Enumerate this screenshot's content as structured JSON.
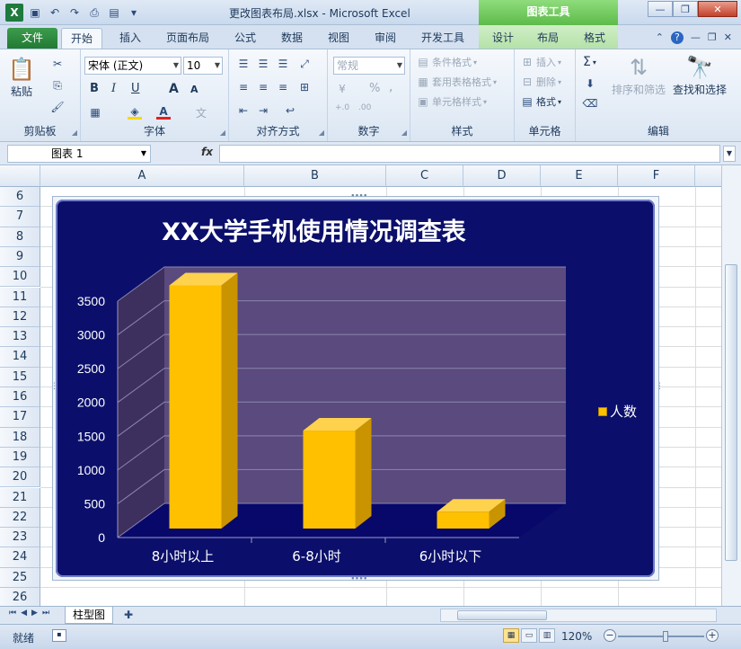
{
  "window": {
    "title": "更改图表布局.xlsx  -  Microsoft Excel",
    "chart_tools": "图表工具"
  },
  "tabs": {
    "file": "文件",
    "items": [
      "开始",
      "插入",
      "页面布局",
      "公式",
      "数据",
      "视图",
      "审阅",
      "开发工具"
    ],
    "context": [
      "设计",
      "布局",
      "格式"
    ]
  },
  "ribbon": {
    "clipboard": {
      "label": "剪贴板",
      "paste": "粘贴"
    },
    "font": {
      "label": "字体",
      "font_name": "宋体 (正文)",
      "font_size": "10",
      "bold": "B",
      "italic": "I",
      "underline": "U",
      "grow": "A",
      "shrink": "A"
    },
    "alignment": {
      "label": "对齐方式"
    },
    "number": {
      "label": "数字",
      "format": "常规",
      "percent": "%",
      "comma": ",",
      "inc": "+.0",
      "dec": ".00"
    },
    "styles": {
      "label": "样式",
      "conditional": "条件格式",
      "table": "套用表格格式",
      "cell": "单元格样式"
    },
    "cells": {
      "label": "单元格",
      "insert": "插入",
      "delete": "删除",
      "format": "格式"
    },
    "editing": {
      "label": "编辑",
      "sort": "排序和筛选",
      "find": "查找和选择",
      "sum": "Σ"
    }
  },
  "formula_bar": {
    "name_box": "图表 1",
    "fx": "fx",
    "value": ""
  },
  "grid": {
    "columns": [
      "A",
      "B",
      "C",
      "D",
      "E",
      "F"
    ],
    "rows": [
      "6",
      "7",
      "8",
      "9",
      "10",
      "11",
      "12",
      "13",
      "14",
      "15",
      "16",
      "17",
      "18",
      "19",
      "20",
      "21",
      "22",
      "23",
      "24",
      "25",
      "26"
    ]
  },
  "chart_data": {
    "type": "bar",
    "title": "XX大学手机使用情况调查表",
    "categories": [
      "8小时以上",
      "6-8小时",
      "6小时以下"
    ],
    "series": [
      {
        "name": "人数",
        "values": [
          3600,
          1450,
          250
        ]
      }
    ],
    "ylim": [
      0,
      3500
    ],
    "yticks": [
      "0",
      "500",
      "1000",
      "1500",
      "2000",
      "2500",
      "3000",
      "3500"
    ],
    "xlabel": "",
    "ylabel": "",
    "grid": true,
    "legend": "right",
    "colors": {
      "bar": "#ffc000",
      "background": "#0b0f6b",
      "wall": "#5a4a7e",
      "floor": "#08086b"
    }
  },
  "sheets": {
    "active": "柱型图"
  },
  "status": {
    "ready": "就绪",
    "zoom": "120%"
  }
}
